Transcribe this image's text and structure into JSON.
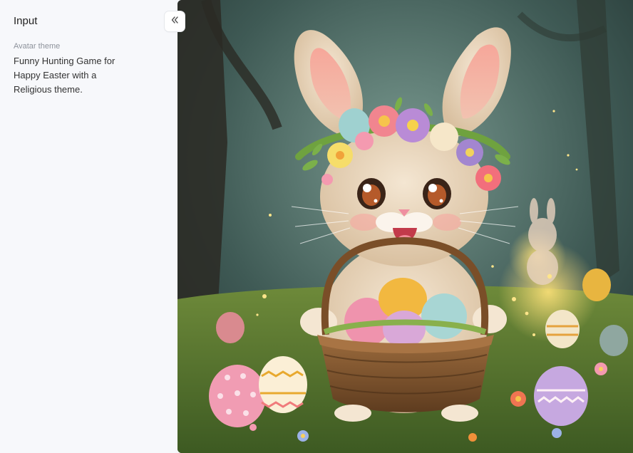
{
  "panel": {
    "title": "Input",
    "field_label": "Avatar theme",
    "field_value": "Funny Hunting Game for Happy Easter with a Religious theme."
  },
  "icons": {
    "collapse": "double-chevron-left-icon"
  },
  "colors": {
    "sidebar_bg": "#f7f8fb",
    "title_text": "#222222",
    "label_text": "#8d929b",
    "value_text": "#333333"
  }
}
